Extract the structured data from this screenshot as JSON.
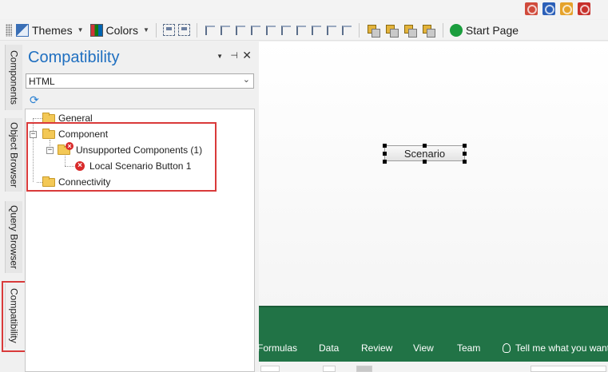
{
  "toolbar": {
    "themes_label": "Themes",
    "colors_label": "Colors",
    "start_page_label": "Start Page"
  },
  "side_tabs": {
    "components": "Components",
    "object_browser": "Object Browser",
    "query_browser": "Query Browser",
    "compatibility": "Compatibility"
  },
  "panel": {
    "title": "Compatibility",
    "format_selected": "HTML",
    "tree": {
      "general": "General",
      "component": "Component",
      "unsupported": "Unsupported Components (1)",
      "local_button": "Local Scenario Button 1",
      "connectivity": "Connectivity"
    }
  },
  "canvas": {
    "button_label": "Scenario"
  },
  "ribbon": {
    "tabs": [
      "Formulas",
      "Data",
      "Review",
      "View",
      "Team"
    ],
    "tell_me": "Tell me what you want"
  },
  "colors": {
    "accent_blue": "#1f6fc0",
    "highlight_red": "#d93a3a",
    "excel_green": "#217346",
    "error_red": "#d92b2b"
  }
}
